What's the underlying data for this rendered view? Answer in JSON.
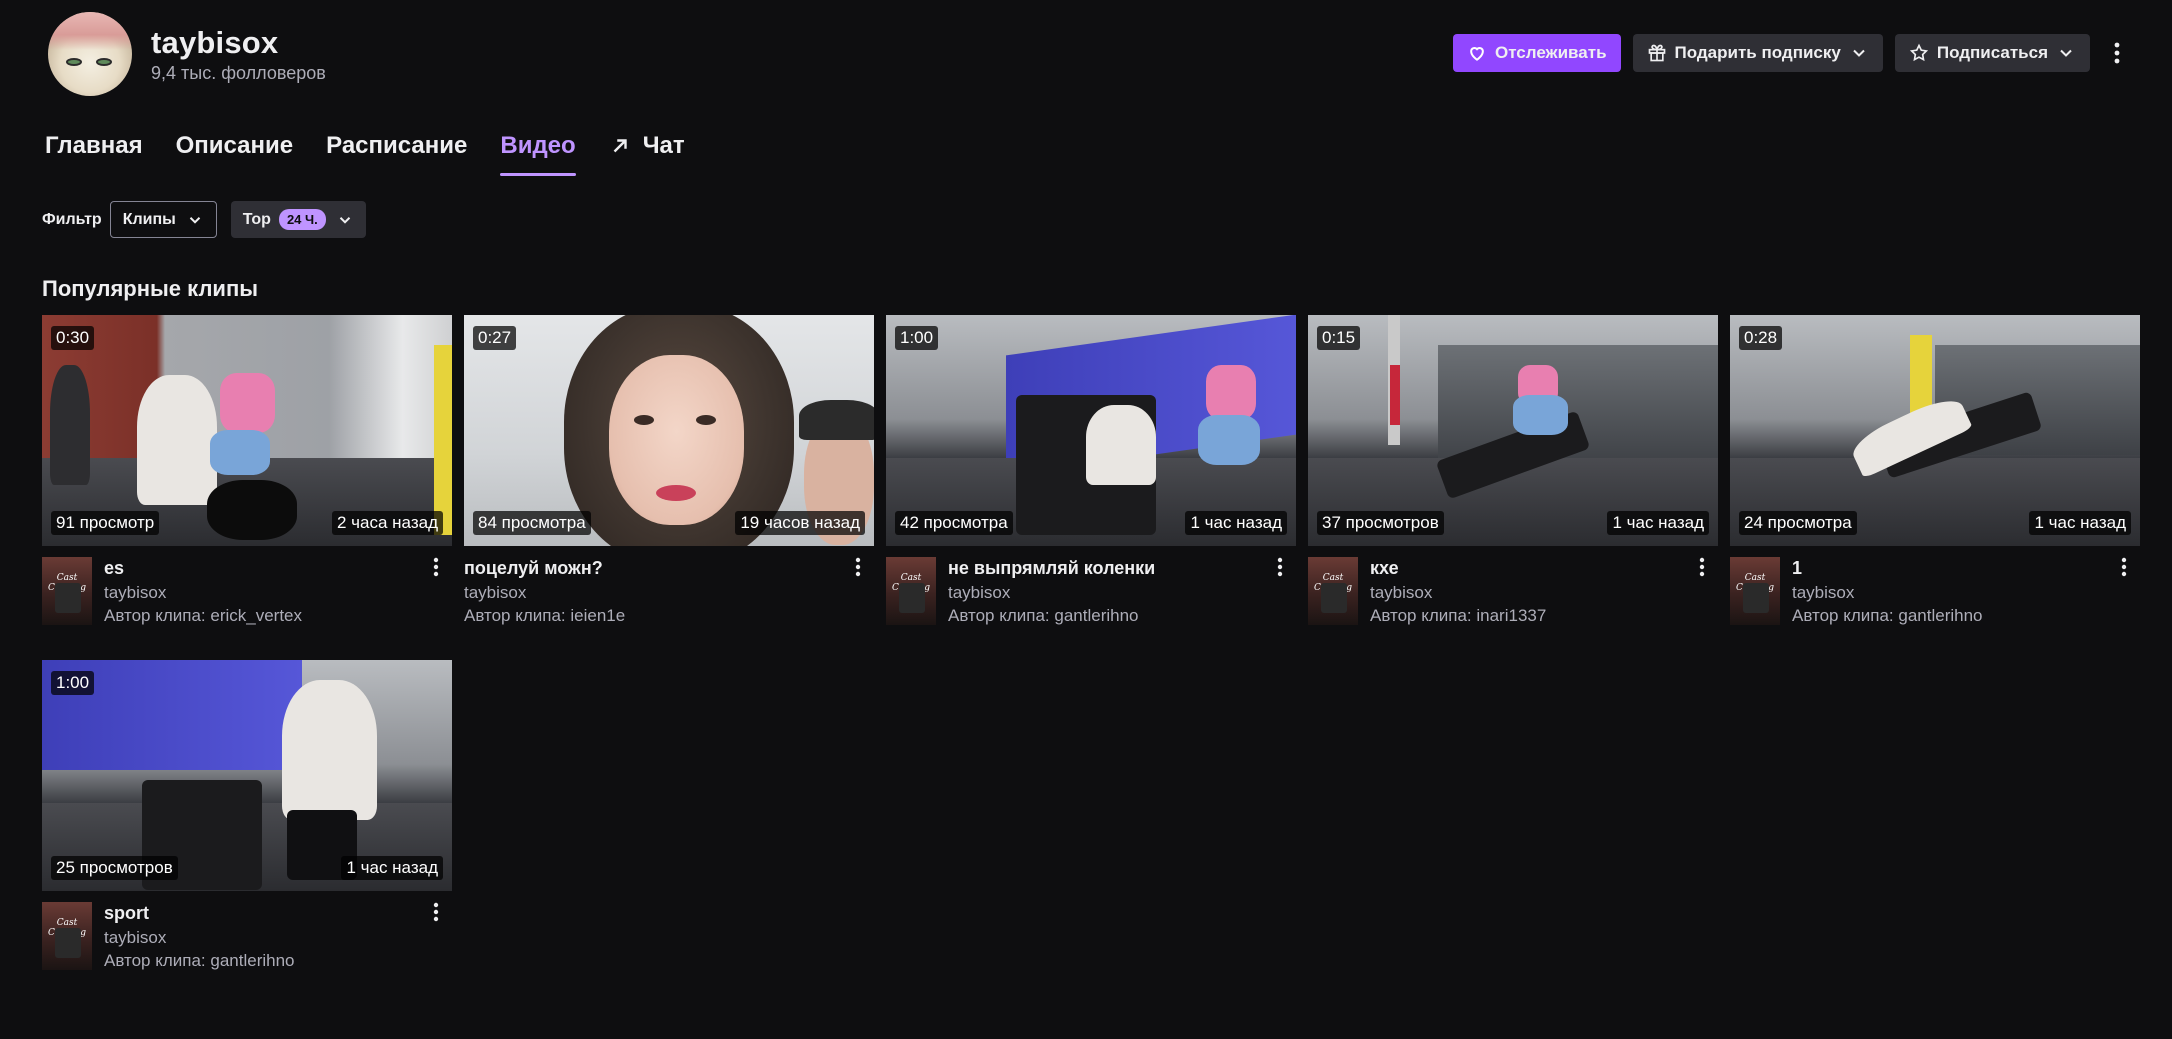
{
  "channel": {
    "name": "taybisox",
    "followers": "9,4 тыс. фолловеров"
  },
  "actions": {
    "follow": "Отслеживать",
    "gift": "Подарить подписку",
    "subscribe": "Подписаться"
  },
  "tabs": [
    {
      "label": "Главная"
    },
    {
      "label": "Описание"
    },
    {
      "label": "Расписание"
    },
    {
      "label": "Видео"
    },
    {
      "label": "Чат"
    }
  ],
  "filters": {
    "label": "Фильтр",
    "type_value": "Клипы",
    "sort_value": "Top",
    "period_pill": "24 Ч."
  },
  "section_title": "Популярные клипы",
  "clips": [
    {
      "duration": "0:30",
      "views": "91 просмотр",
      "ago": "2 часа назад",
      "title": "es",
      "channel": "taybisox",
      "author": "Автор клипа: erick_vertex"
    },
    {
      "duration": "0:27",
      "views": "84 просмотра",
      "ago": "19 часов назад",
      "title": "поцелуй можн?",
      "channel": "taybisox",
      "author": "Автор клипа: ieien1e"
    },
    {
      "duration": "1:00",
      "views": "42 просмотра",
      "ago": "1 час назад",
      "title": "не выпрямляй коленки",
      "channel": "taybisox",
      "author": "Автор клипа: gantlerihno"
    },
    {
      "duration": "0:15",
      "views": "37 просмотров",
      "ago": "1 час назад",
      "title": "кхе",
      "channel": "taybisox",
      "author": "Автор клипа: inari1337"
    },
    {
      "duration": "0:28",
      "views": "24 просмотра",
      "ago": "1 час назад",
      "title": "1",
      "channel": "taybisox",
      "author": "Автор клипа: gantlerihno"
    },
    {
      "duration": "1:00",
      "views": "25 просмотров",
      "ago": "1 час назад",
      "title": "sport",
      "channel": "taybisox",
      "author": "Автор клипа: gantlerihno"
    }
  ],
  "colors": {
    "background": "#0e0e10",
    "accent": "#9147ff",
    "accent_light": "#bf94ff",
    "button": "#2f2f35",
    "muted_text": "#adadb8"
  },
  "icons": [
    "heart-icon",
    "gift-icon",
    "star-icon",
    "chevron-down-icon",
    "kebab-menu-icon",
    "external-arrow-icon"
  ]
}
